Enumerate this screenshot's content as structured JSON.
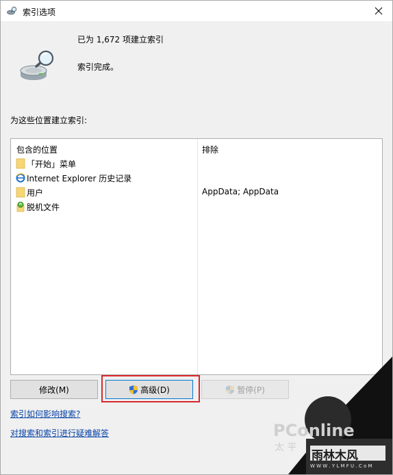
{
  "window": {
    "title": "索引选项"
  },
  "status": {
    "count_text": "已为 1,672 项建立索引",
    "state_text": "索引完成。"
  },
  "section_label": "为这些位置建立索引:",
  "table": {
    "col_included": "包含的位置",
    "col_excluded": "排除",
    "rows": [
      {
        "location": "「开始」菜单",
        "exclude": "",
        "icon": "folder-icon"
      },
      {
        "location": "Internet Explorer 历史记录",
        "exclude": "",
        "icon": "ie-icon"
      },
      {
        "location": "用户",
        "exclude": "AppData; AppData",
        "icon": "folder-icon"
      },
      {
        "location": "脱机文件",
        "exclude": "",
        "icon": "offline-files-icon"
      }
    ]
  },
  "buttons": {
    "modify": "修改(M)",
    "advanced": "高级(D)",
    "pause": "暂停(P)"
  },
  "links": {
    "how_affects": "索引如何影响搜索?",
    "troubleshoot": "对搜索和索引进行疑难解答"
  },
  "watermark": {
    "brand": "PConline",
    "brand_sub": "太 平",
    "site": "雨林木风",
    "site_url": "W W W . Y L M F U . C o M"
  },
  "colors": {
    "link": "#0a46a8",
    "highlight": "#d9262b",
    "window_bg": "#f0f0f0"
  }
}
